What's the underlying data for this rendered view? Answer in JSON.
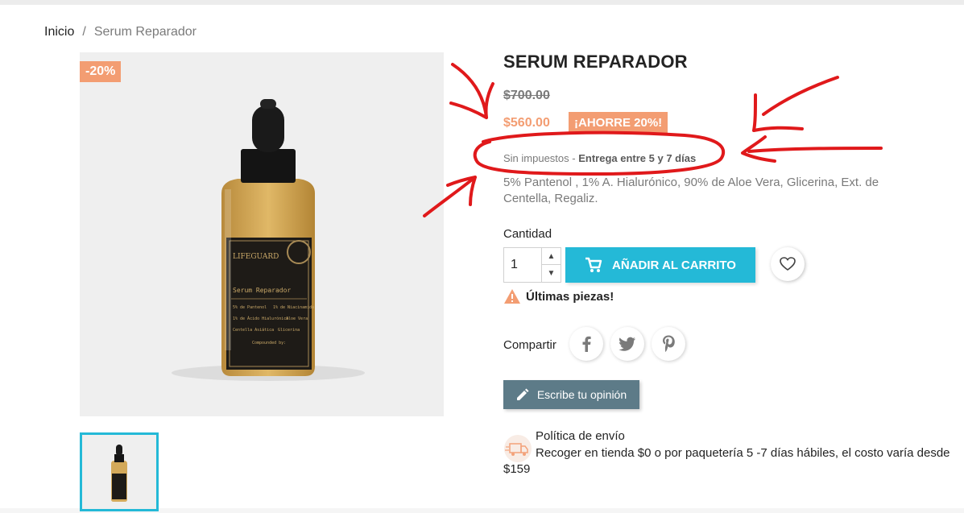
{
  "breadcrumb": {
    "home": "Inicio",
    "separator": "/",
    "current": "Serum Reparador"
  },
  "product": {
    "discount_flag": "-20%",
    "title": "SERUM REPARADOR",
    "old_price": "$700.00",
    "price": "$560.00",
    "save_badge": "¡AHORRE 20%!",
    "tax_prefix": "Sin impuestos",
    "tax_sep": " - ",
    "delivery": "Entrega entre 5 y 7 días",
    "description": "5% Pantenol , 1% A. Hialurónico, 90% de Aloe Vera, Glicerina, Ext. de Centella, Regaliz.",
    "bottle_label": {
      "brand": "LIFEGUARD",
      "name": "Serum Reparador",
      "lines": [
        "5% de Pantenol",
        "1% de Niacinamida",
        "1% de Ácido Hialurónico",
        "Aloe Vera",
        "Centella Asiática",
        "Glicerina",
        "Compounded by:"
      ]
    }
  },
  "purchase": {
    "qty_label": "Cantidad",
    "qty_value": "1",
    "add_to_cart": "AÑADIR AL CARRITO",
    "stock_notice": "Últimas piezas!"
  },
  "share": {
    "label": "Compartir",
    "networks": [
      "facebook",
      "twitter",
      "pinterest"
    ]
  },
  "review": {
    "button": "Escribe tu opinión"
  },
  "shipping": {
    "title": "Política de envío",
    "text": "Recoger en tienda $0 o por paquetería 5 -7 días hábiles, el costo varía desde $159"
  },
  "colors": {
    "accent": "#24b9d7",
    "discount": "#f39d72",
    "review_button": "#5d7b88",
    "annotation": "#e0191b"
  },
  "icons": [
    "cart-icon",
    "heart-icon",
    "warning-icon",
    "facebook-icon",
    "twitter-icon",
    "pinterest-icon",
    "pencil-icon",
    "truck-icon"
  ]
}
